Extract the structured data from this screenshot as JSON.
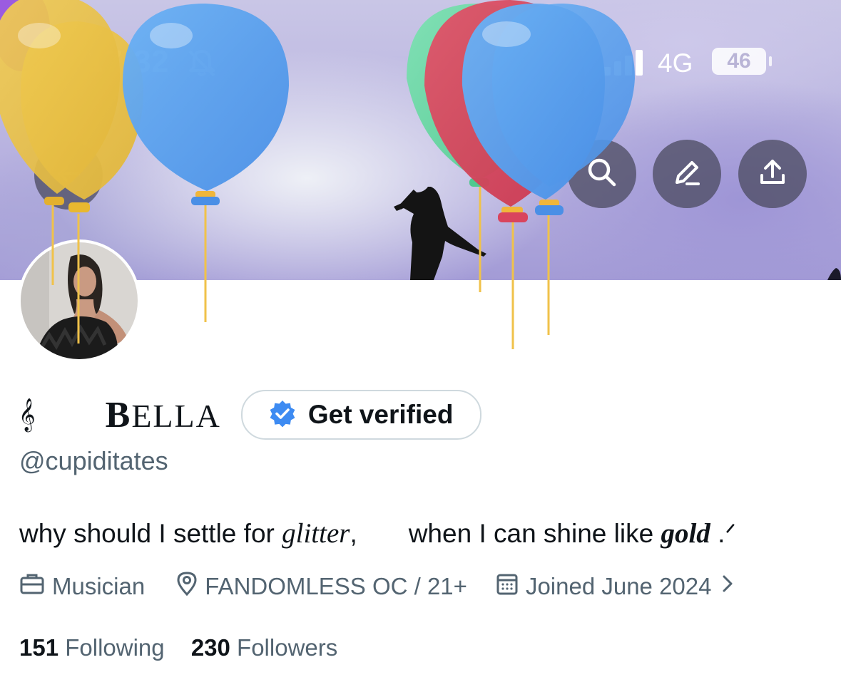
{
  "status_bar": {
    "time": "17:32",
    "network": "4G",
    "battery": "46"
  },
  "header_actions": {
    "back": "back-arrow-icon",
    "search": "search-icon",
    "edit": "pencil-icon",
    "share": "share-upload-icon"
  },
  "profile": {
    "name_prefix": "𝄞",
    "name_first": "B",
    "name_rest": "ELLA",
    "verify_label": "Get verified",
    "handle": "@cupiditates",
    "bio": {
      "part1": "why should I settle for ",
      "glitter": "glitter",
      "part2": ",       when I can shine like ",
      "gold": "gold",
      "part3": " .ᐟ"
    },
    "profession": "Musician",
    "location": "FANDOMLESS OC / 21+",
    "joined": "Joined June 2024",
    "following_count": "151",
    "following_label": "Following",
    "followers_count": "230",
    "followers_label": "Followers"
  },
  "colors": {
    "accent": "#1d9bf0",
    "verify_badge": "#3d8bf2",
    "muted_text": "#536471",
    "balloon_yellow": "#e8c24a",
    "balloon_blue": "#5aa1ee",
    "balloon_red": "#d9445d",
    "balloon_green": "#5ed6a0"
  }
}
